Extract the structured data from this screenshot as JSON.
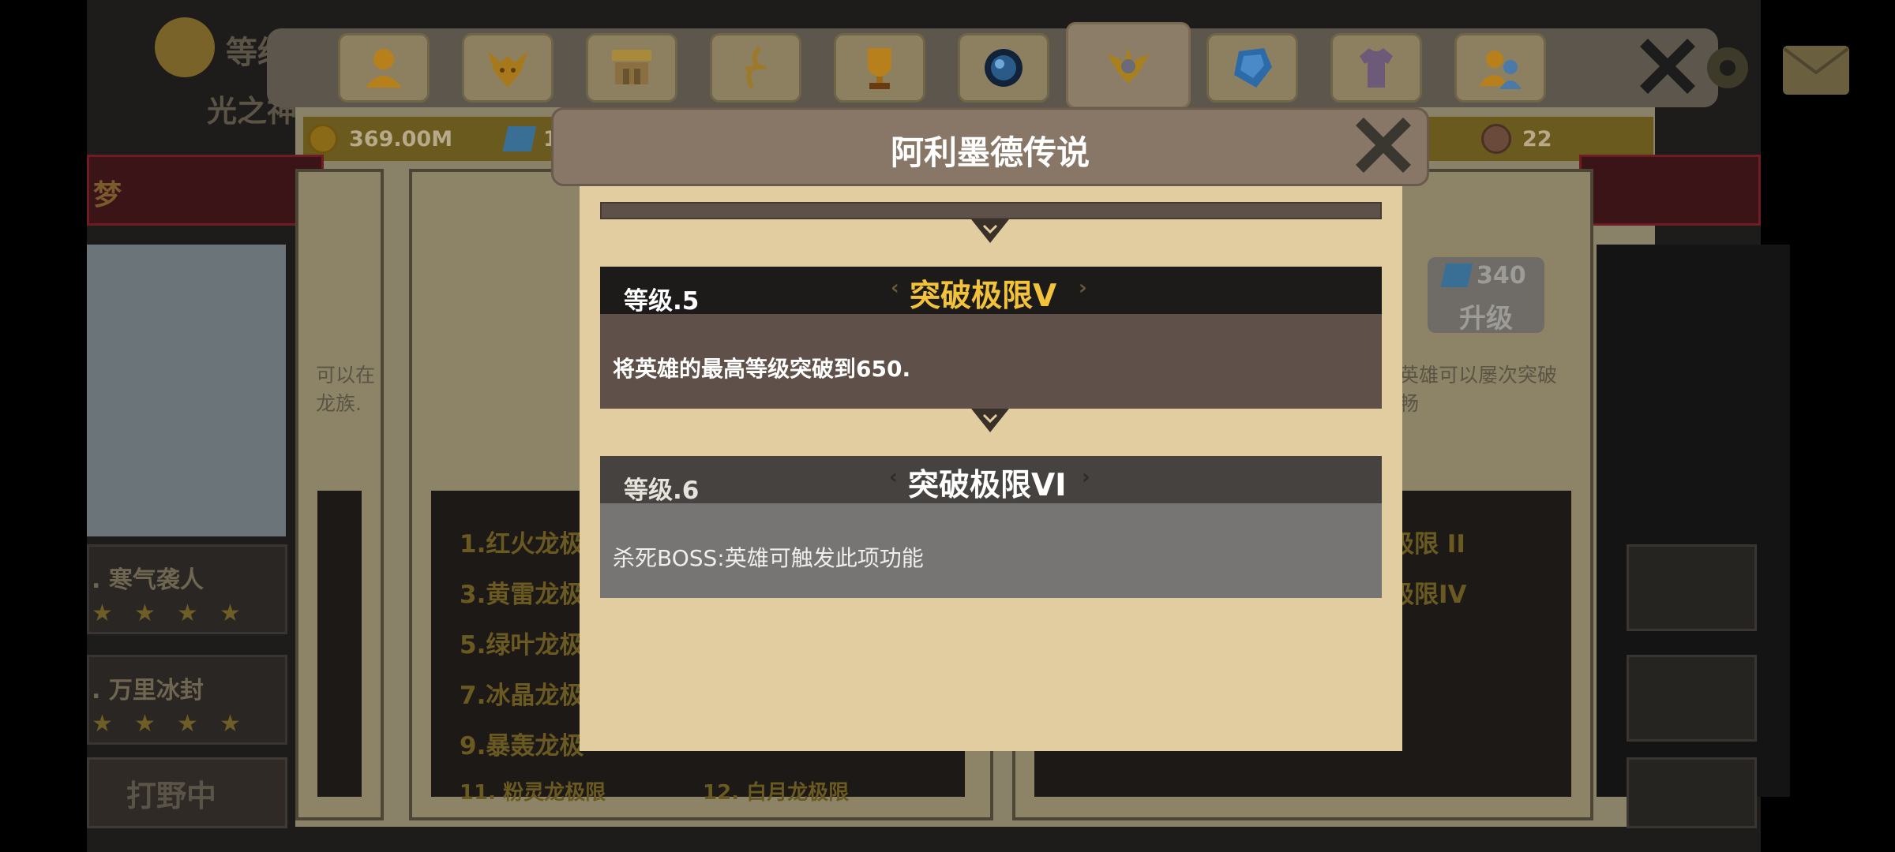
{
  "modal": {
    "title": "阿利墨德传说",
    "levels": [
      {
        "level": "等级.5",
        "title": "突破极限V",
        "desc": "将英雄的最高等级突破到650.",
        "state": "unlocked",
        "title_color": "#f2c23a"
      },
      {
        "level": "等级.6",
        "title": "突破极限VI",
        "desc": "杀死BOSS:英雄可触发此项功能",
        "state": "locked",
        "title_color": "#ffffff"
      }
    ]
  },
  "header": {
    "level_label": "等级",
    "subtitle": "光之神"
  },
  "resources": {
    "gold": "369.00M",
    "gem_partial": "1",
    "token": "22"
  },
  "tabs": [
    {
      "icon": "hero-icon"
    },
    {
      "icon": "dragon-head-icon"
    },
    {
      "icon": "shop-icon"
    },
    {
      "icon": "rune-icon"
    },
    {
      "icon": "trophy-icon"
    },
    {
      "icon": "orb-icon"
    },
    {
      "icon": "relic-icon",
      "active": true
    },
    {
      "icon": "crystal-icon"
    },
    {
      "icon": "shirt-icon"
    },
    {
      "icon": "friends-icon"
    }
  ],
  "background": {
    "left_banner": "梦",
    "skill1": ". 寒气袭人",
    "skill2": ". 万里冰封",
    "hunting": "打野中",
    "side_text_1": "可以在",
    "side_text_2": "龙族.",
    "list_items": [
      "1.红火龙极",
      "3.黄雷龙极",
      "5.绿叶龙极",
      "7.冰晶龙极",
      "9.暴轰龙极",
      "11. 粉灵龙极限",
      "12. 白月龙极限"
    ],
    "right_items": [
      "极限 II",
      "极限IV"
    ],
    "right_text_1": "英雄可以屡次突破",
    "right_text_2": "畅",
    "upgrade_cost": "340",
    "upgrade_label": "升级"
  }
}
